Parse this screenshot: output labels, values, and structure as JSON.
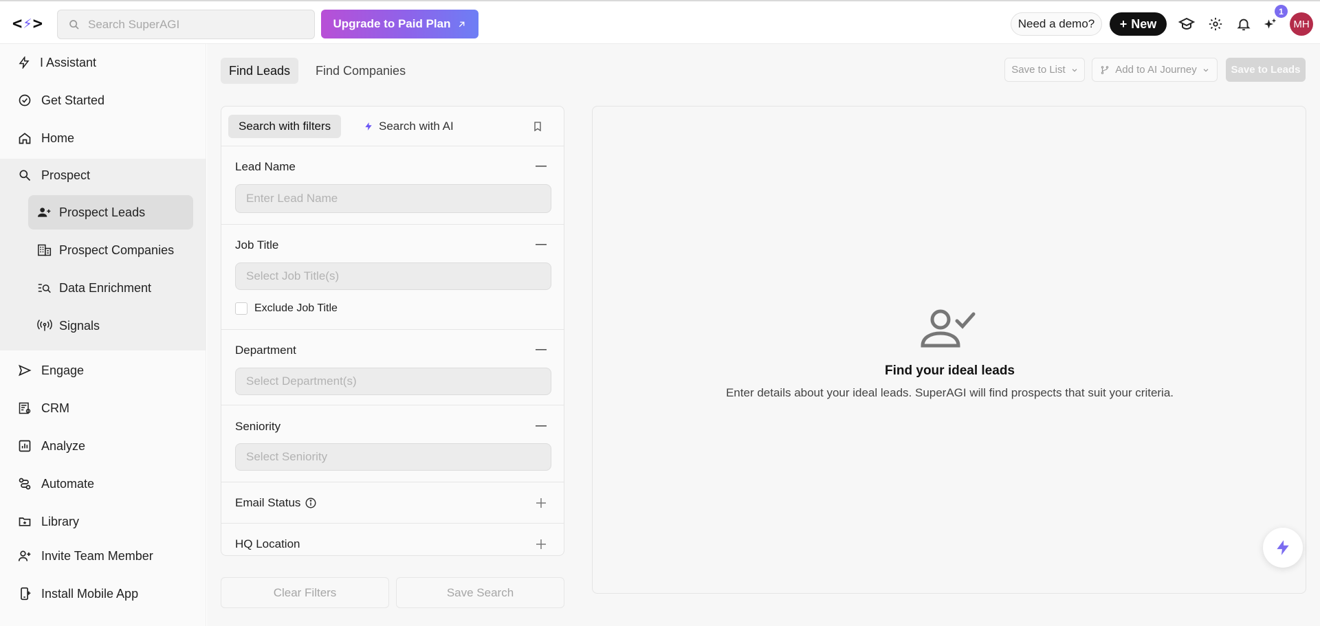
{
  "topbar": {
    "search_placeholder": "Search SuperAGI",
    "upgrade_label": "Upgrade to Paid Plan",
    "demo_label": "Need a demo?",
    "new_label": "New",
    "notification_badge": "1",
    "avatar_initials": "MH"
  },
  "sidebar": {
    "items": [
      {
        "label": "I Assistant",
        "icon": "lightning-icon"
      },
      {
        "label": "Get Started",
        "icon": "check-circle-icon"
      },
      {
        "label": "Home",
        "icon": "home-icon"
      },
      {
        "label": "Prospect",
        "icon": "search-icon"
      },
      {
        "label": "Engage",
        "icon": "send-icon"
      },
      {
        "label": "CRM",
        "icon": "crm-icon"
      },
      {
        "label": "Analyze",
        "icon": "chart-icon"
      },
      {
        "label": "Automate",
        "icon": "automate-icon"
      },
      {
        "label": "Library",
        "icon": "folder-icon"
      },
      {
        "label": "Invite Team Member",
        "icon": "user-plus-icon"
      },
      {
        "label": "Install Mobile App",
        "icon": "mobile-icon"
      }
    ],
    "prospect_sub": [
      {
        "label": "Prospect Leads",
        "icon": "users-plus-icon",
        "active": true
      },
      {
        "label": "Prospect Companies",
        "icon": "building-icon"
      },
      {
        "label": "Data Enrichment",
        "icon": "list-search-icon"
      },
      {
        "label": "Signals",
        "icon": "signal-icon"
      }
    ]
  },
  "main": {
    "tabs": [
      {
        "label": "Find Leads",
        "active": true
      },
      {
        "label": "Find Companies"
      }
    ],
    "save_to_list": "Save to List",
    "add_to_journey": "Add to AI Journey",
    "save_to_leads": "Save to Leads",
    "filters": {
      "mode_filters": "Search with filters",
      "mode_ai": "Search with AI",
      "lead_name": {
        "title": "Lead Name",
        "placeholder": "Enter Lead Name"
      },
      "job_title": {
        "title": "Job Title",
        "placeholder": "Select Job Title(s)",
        "exclude_label": "Exclude Job Title"
      },
      "department": {
        "title": "Department",
        "placeholder": "Select Department(s)"
      },
      "seniority": {
        "title": "Seniority",
        "placeholder": "Select Seniority"
      },
      "email_status": {
        "title": "Email Status"
      },
      "hq_location": {
        "title": "HQ Location"
      }
    },
    "clear_filters": "Clear Filters",
    "save_search": "Save Search",
    "empty_state": {
      "title": "Find your ideal leads",
      "subtitle": "Enter details about your ideal leads. SuperAGI will find prospects that suit your criteria."
    }
  },
  "colors": {
    "accent": "#6b57f5",
    "upgrade_gradient_start": "#b84fd6",
    "upgrade_gradient_end": "#6d7ef5",
    "avatar_bg": "#b42c4a"
  }
}
